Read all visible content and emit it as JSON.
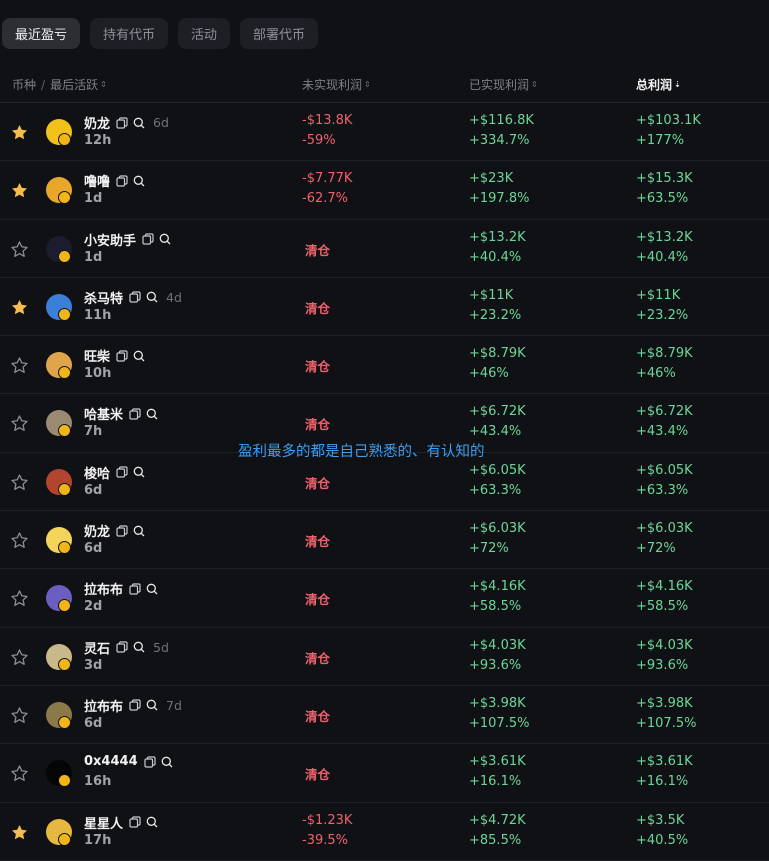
{
  "tabs": [
    {
      "label": "最近盈亏",
      "active": true
    },
    {
      "label": "持有代币",
      "active": false
    },
    {
      "label": "活动",
      "active": false
    },
    {
      "label": "部署代币",
      "active": false
    }
  ],
  "header": {
    "token": "币种",
    "separator": "/",
    "last_active": "最后活跃",
    "unrealized": "未实现利润",
    "realized": "已实现利润",
    "total": "总利润",
    "sort_icon": "⇕",
    "sort_desc_icon": "⇣"
  },
  "overlay_text": "盈利最多的都是自己熟悉的、有认知的",
  "colors": {
    "positive": "#6ed59a",
    "negative": "#f0616d",
    "star": "#f5bd4f",
    "badge": "#f2b518"
  },
  "rows": [
    {
      "starred": true,
      "name": "奶龙",
      "age": "6d",
      "last_active": "12h",
      "unrealized_value": "-$13.8K",
      "unrealized_pct": "-59%",
      "cleared": false,
      "cleared_label": "",
      "realized_value": "+$116.8K",
      "realized_pct": "+334.7%",
      "total_value": "+$103.1K",
      "total_pct": "+177%",
      "avatar_color": "#f3c21a"
    },
    {
      "starred": true,
      "name": "噜噜",
      "age": "",
      "last_active": "1d",
      "unrealized_value": "-$7.77K",
      "unrealized_pct": "-62.7%",
      "cleared": false,
      "cleared_label": "",
      "realized_value": "+$23K",
      "realized_pct": "+197.8%",
      "total_value": "+$15.3K",
      "total_pct": "+63.5%",
      "avatar_color": "#e8a72a"
    },
    {
      "starred": false,
      "name": "小安助手",
      "age": "",
      "last_active": "1d",
      "unrealized_value": "",
      "unrealized_pct": "",
      "cleared": true,
      "cleared_label": "清仓",
      "realized_value": "+$13.2K",
      "realized_pct": "+40.4%",
      "total_value": "+$13.2K",
      "total_pct": "+40.4%",
      "avatar_color": "#1b1c2e"
    },
    {
      "starred": true,
      "name": "杀马特",
      "age": "4d",
      "last_active": "11h",
      "unrealized_value": "",
      "unrealized_pct": "",
      "cleared": true,
      "cleared_label": "清仓",
      "realized_value": "+$11K",
      "realized_pct": "+23.2%",
      "total_value": "+$11K",
      "total_pct": "+23.2%",
      "avatar_color": "#3a7fd8"
    },
    {
      "starred": false,
      "name": "旺柴",
      "age": "",
      "last_active": "10h",
      "unrealized_value": "",
      "unrealized_pct": "",
      "cleared": true,
      "cleared_label": "清仓",
      "realized_value": "+$8.79K",
      "realized_pct": "+46%",
      "total_value": "+$8.79K",
      "total_pct": "+46%",
      "avatar_color": "#e0a44a"
    },
    {
      "starred": false,
      "name": "哈基米",
      "age": "",
      "last_active": "7h",
      "unrealized_value": "",
      "unrealized_pct": "",
      "cleared": true,
      "cleared_label": "清仓",
      "realized_value": "+$6.72K",
      "realized_pct": "+43.4%",
      "total_value": "+$6.72K",
      "total_pct": "+43.4%",
      "avatar_color": "#9b8a72"
    },
    {
      "starred": false,
      "name": "梭哈",
      "age": "",
      "last_active": "6d",
      "unrealized_value": "",
      "unrealized_pct": "",
      "cleared": true,
      "cleared_label": "清仓",
      "realized_value": "+$6.05K",
      "realized_pct": "+63.3%",
      "total_value": "+$6.05K",
      "total_pct": "+63.3%",
      "avatar_color": "#b2452e"
    },
    {
      "starred": false,
      "name": "奶龙",
      "age": "",
      "last_active": "6d",
      "unrealized_value": "",
      "unrealized_pct": "",
      "cleared": true,
      "cleared_label": "清仓",
      "realized_value": "+$6.03K",
      "realized_pct": "+72%",
      "total_value": "+$6.03K",
      "total_pct": "+72%",
      "avatar_color": "#f5d45a"
    },
    {
      "starred": false,
      "name": "拉布布",
      "age": "",
      "last_active": "2d",
      "unrealized_value": "",
      "unrealized_pct": "",
      "cleared": true,
      "cleared_label": "清仓",
      "realized_value": "+$4.16K",
      "realized_pct": "+58.5%",
      "total_value": "+$4.16K",
      "total_pct": "+58.5%",
      "avatar_color": "#6a5ec0"
    },
    {
      "starred": false,
      "name": "灵石",
      "age": "5d",
      "last_active": "3d",
      "unrealized_value": "",
      "unrealized_pct": "",
      "cleared": true,
      "cleared_label": "清仓",
      "realized_value": "+$4.03K",
      "realized_pct": "+93.6%",
      "total_value": "+$4.03K",
      "total_pct": "+93.6%",
      "avatar_color": "#c9b98a"
    },
    {
      "starred": false,
      "name": "拉布布",
      "age": "7d",
      "last_active": "6d",
      "unrealized_value": "",
      "unrealized_pct": "",
      "cleared": true,
      "cleared_label": "清仓",
      "realized_value": "+$3.98K",
      "realized_pct": "+107.5%",
      "total_value": "+$3.98K",
      "total_pct": "+107.5%",
      "avatar_color": "#8a7a4a"
    },
    {
      "starred": false,
      "name": "0x4444",
      "age": "",
      "last_active": "16h",
      "unrealized_value": "",
      "unrealized_pct": "",
      "cleared": true,
      "cleared_label": "清仓",
      "realized_value": "+$3.61K",
      "realized_pct": "+16.1%",
      "total_value": "+$3.61K",
      "total_pct": "+16.1%",
      "avatar_color": "#050505"
    },
    {
      "starred": true,
      "name": "星星人",
      "age": "",
      "last_active": "17h",
      "unrealized_value": "-$1.23K",
      "unrealized_pct": "-39.5%",
      "cleared": false,
      "cleared_label": "",
      "realized_value": "+$4.72K",
      "realized_pct": "+85.5%",
      "total_value": "+$3.5K",
      "total_pct": "+40.5%",
      "avatar_color": "#e7b840"
    }
  ]
}
